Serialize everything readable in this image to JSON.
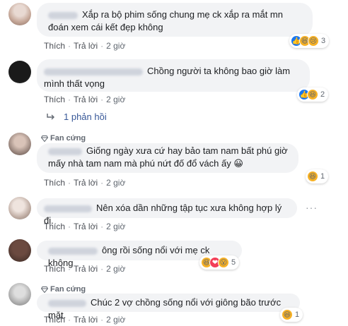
{
  "actions": {
    "like": "Thích",
    "reply": "Trả lời"
  },
  "replies_link": "1 phản hồi",
  "fan_badge": "Fan cứng",
  "comments": [
    {
      "text": "Xắp ra bộ phim sống chung mẹ ck xắp ra mắt mn đoán xem cái kết đẹp không",
      "time": "2 giờ",
      "reaction_count": "3"
    },
    {
      "text": "Chồng người ta không bao giờ làm mình thất vọng",
      "time": "2 giờ",
      "reaction_count": "2"
    },
    {
      "text": "Giống ngày xưa cứ hay bảo tam nam bất phú giờ mấy nhà tam nam mà phú nứt đố đổ vách ấy 😀",
      "time": "2 giờ",
      "reaction_count": "1"
    },
    {
      "text": "Nên xóa dần những tập tục xưa không hợp lý đi.",
      "time": "2 giờ",
      "reaction_count": ""
    },
    {
      "text": "ông rồi sống nổi với mẹ ck không",
      "time": "2 giờ",
      "reaction_count": "5"
    },
    {
      "text": "Chúc 2 vợ chồng sống nổi với giông bão trước mặt.",
      "time": "2 giờ",
      "reaction_count": "1"
    }
  ],
  "colors": {
    "link": "#385898",
    "bubble": "#f2f3f5",
    "like": "#1877f2"
  },
  "icons": [
    "diamond-icon",
    "reply-arrow-icon",
    "like-reaction-icon",
    "haha-reaction-icon",
    "sad-reaction-icon",
    "love-reaction-icon",
    "wow-reaction-icon",
    "more-options-icon"
  ]
}
